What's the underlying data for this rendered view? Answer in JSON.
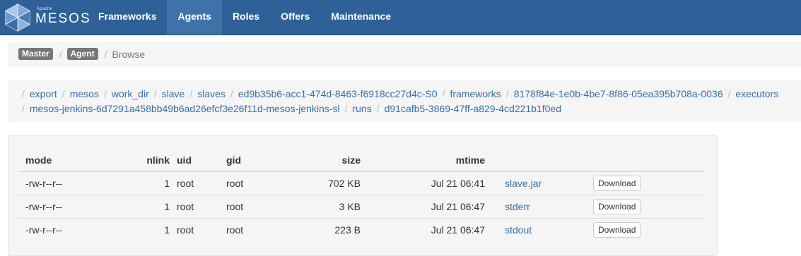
{
  "brand": {
    "apache": "Apache",
    "name": "MESOS"
  },
  "nav": {
    "items": [
      {
        "label": "Frameworks",
        "active": false
      },
      {
        "label": "Agents",
        "active": true
      },
      {
        "label": "Roles",
        "active": false
      },
      {
        "label": "Offers",
        "active": false
      },
      {
        "label": "Maintenance",
        "active": false
      }
    ]
  },
  "breadcrumb": {
    "master": "Master",
    "agent": "Agent",
    "current": "Browse",
    "separator": "/"
  },
  "path": {
    "separator": "/",
    "line1": [
      "export",
      "mesos",
      "work_dir",
      "slave",
      "slaves",
      "ed9b35b6-acc1-474d-8463-f6918cc27d4c-S0",
      "frameworks",
      "8178f84e-1e0b-4be7-8f86-05ea395b708a-0036",
      "executors"
    ],
    "line2": [
      "mesos-jenkins-6d7291a458bb49b6ad26efcf3e26f11d-mesos-jenkins-sl",
      "runs",
      "d91cafb5-3869-47ff-a829-4cd221b1f0ed"
    ]
  },
  "files": {
    "headers": {
      "mode": "mode",
      "nlink": "nlink",
      "uid": "uid",
      "gid": "gid",
      "size": "size",
      "mtime": "mtime"
    },
    "download_label": "Download",
    "rows": [
      {
        "mode": "-rw-r--r--",
        "nlink": "1",
        "uid": "root",
        "gid": "root",
        "size": "702 KB",
        "mtime": "Jul 21 06:41",
        "name": "slave.jar"
      },
      {
        "mode": "-rw-r--r--",
        "nlink": "1",
        "uid": "root",
        "gid": "root",
        "size": "3 KB",
        "mtime": "Jul 21 06:47",
        "name": "stderr"
      },
      {
        "mode": "-rw-r--r--",
        "nlink": "1",
        "uid": "root",
        "gid": "root",
        "size": "223 B",
        "mtime": "Jul 21 06:47",
        "name": "stdout"
      }
    ]
  },
  "colors": {
    "navbar": "#2f6198",
    "nav_active": "#3f72a8",
    "link": "#3a6ea5"
  },
  "icons": {
    "logo": "mesos-hexagon-logo-icon"
  }
}
